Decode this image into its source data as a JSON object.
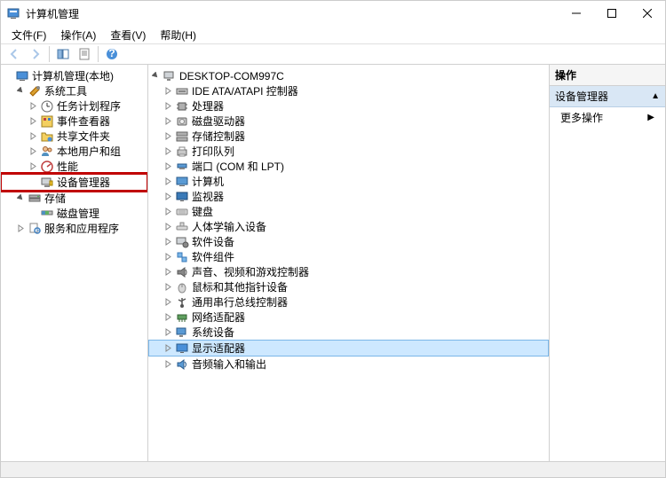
{
  "window": {
    "title": "计算机管理"
  },
  "menu": {
    "file": "文件(F)",
    "action": "操作(A)",
    "view": "查看(V)",
    "help": "帮助(H)"
  },
  "left_tree": {
    "root": "计算机管理(本地)",
    "tools": "系统工具",
    "tools_children": {
      "tasksched": "任务计划程序",
      "eventvwr": "事件查看器",
      "shared": "共享文件夹",
      "localusers": "本地用户和组",
      "perf": "性能",
      "devmgr": "设备管理器"
    },
    "storage": "存储",
    "storage_children": {
      "diskmgmt": "磁盘管理"
    },
    "services": "服务和应用程序"
  },
  "center_tree": {
    "root": "DESKTOP-COM997C",
    "items": {
      "ide": "IDE ATA/ATAPI 控制器",
      "cpu": "处理器",
      "disk": "磁盘驱动器",
      "storctrl": "存储控制器",
      "printq": "打印队列",
      "ports": "端口 (COM 和 LPT)",
      "computer": "计算机",
      "monitor": "监视器",
      "keyboard": "键盘",
      "hid": "人体学输入设备",
      "software": "软件设备",
      "swcomp": "软件组件",
      "media": "声音、视频和游戏控制器",
      "mouse": "鼠标和其他指针设备",
      "usb": "通用串行总线控制器",
      "network": "网络适配器",
      "system": "系统设备",
      "display": "显示适配器",
      "audio": "音频输入和输出"
    }
  },
  "right_pane": {
    "header": "操作",
    "section": "设备管理器",
    "more": "更多操作"
  }
}
